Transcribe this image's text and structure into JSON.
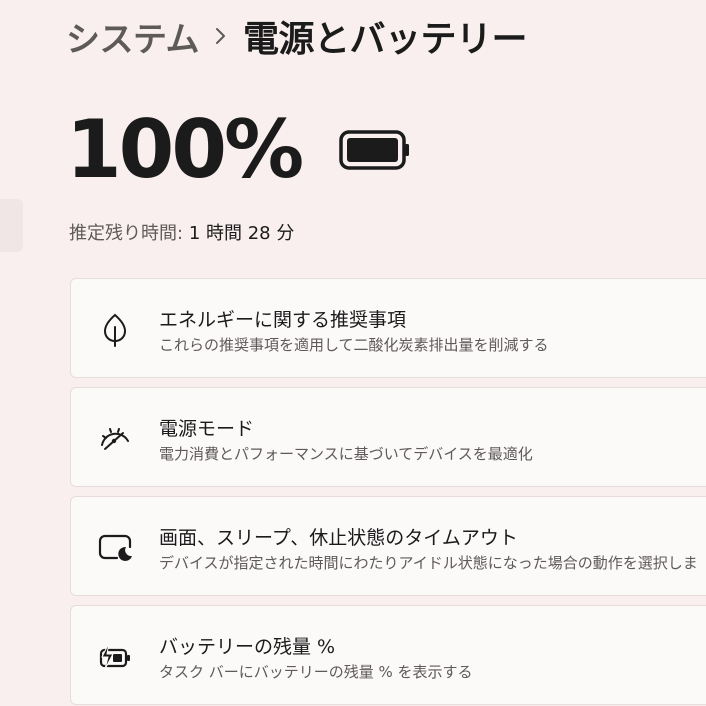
{
  "breadcrumb": {
    "parent": "システム",
    "separator_icon": "chevron-right-icon",
    "current": "電源とバッテリー"
  },
  "battery": {
    "percent_text": "100%",
    "level": 1.0,
    "icon": "battery-full-icon"
  },
  "remaining": {
    "label": "推定残り時間:",
    "value": "1 時間 28 分"
  },
  "cards": [
    {
      "icon": "leaf-icon",
      "title": "エネルギーに関する推奨事項",
      "subtitle": "これらの推奨事項を適用して二酸化炭素排出量を削減する"
    },
    {
      "icon": "gauge-icon",
      "title": "電源モード",
      "subtitle": "電力消費とパフォーマンスに基づいてデバイスを最適化"
    },
    {
      "icon": "screen-sleep-icon",
      "title": "画面、スリープ、休止状態のタイムアウト",
      "subtitle": "デバイスが指定された時間にわたりアイドル状態になった場合の動作を選択しま"
    },
    {
      "icon": "battery-saver-icon",
      "title": "バッテリーの残量 %",
      "subtitle": "タスク バーにバッテリーの残量 % を表示する"
    }
  ],
  "colors": {
    "background": "#f8efee",
    "card": "#fcf9f9",
    "text_primary": "#1b1b1b",
    "text_secondary": "#5f5a5a"
  }
}
